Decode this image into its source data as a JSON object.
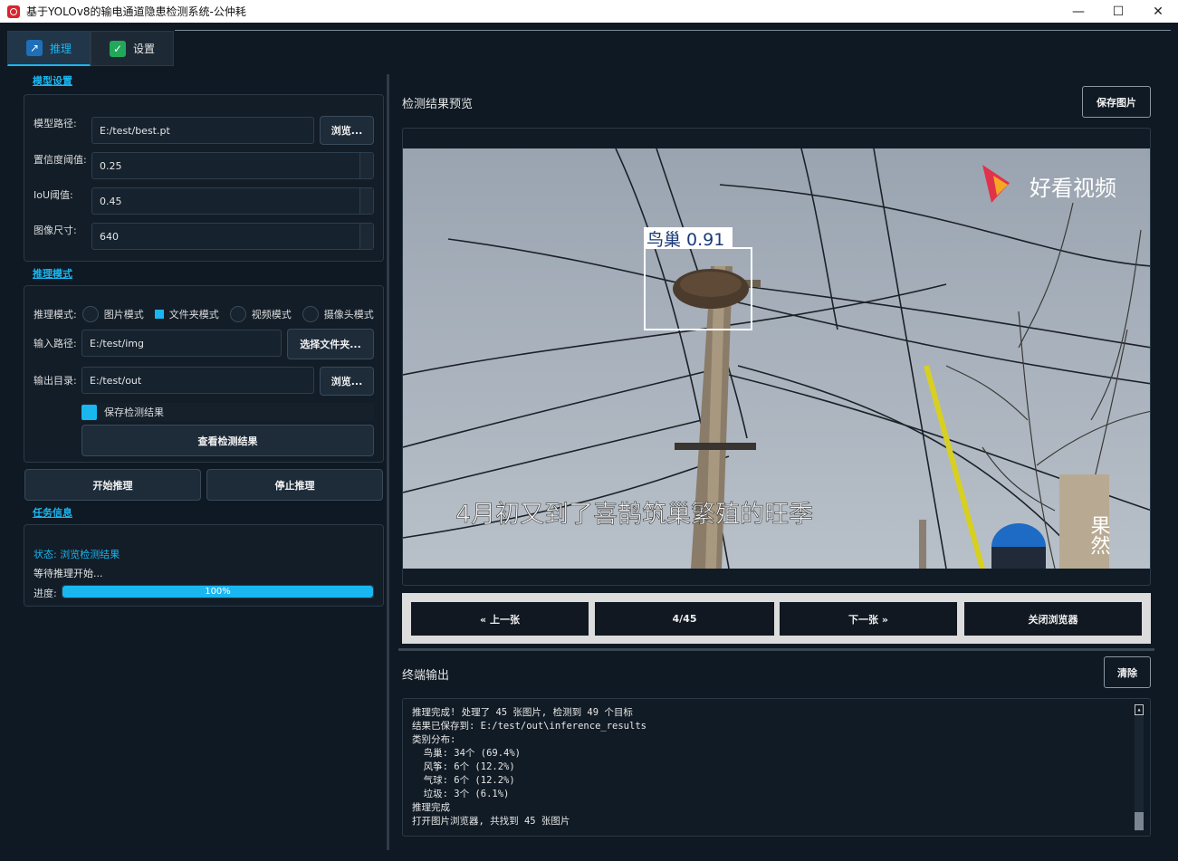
{
  "window": {
    "title": "基于YOLOv8的输电通道隐患检测系统-公仲耗",
    "controls": [
      "—",
      "☐",
      "✕"
    ]
  },
  "tabs": [
    {
      "label": "推理",
      "icon": "chart-icon",
      "active": true
    },
    {
      "label": "设置",
      "icon": "check-icon",
      "active": false
    }
  ],
  "model": {
    "section_title": "模型设置",
    "path_label": "模型路径:",
    "path_value": "E:/test/best.pt",
    "browse_label": "浏览...",
    "conf_label": "置信度阈值:",
    "conf_value": "0.25",
    "iou_label": "IoU阈值:",
    "iou_value": "0.45",
    "imgsz_label": "图像尺寸:",
    "imgsz_value": "640"
  },
  "mode": {
    "section_title": "推理模式",
    "mode_label": "推理模式:",
    "options": [
      "图片模式",
      "文件夹模式",
      "视频模式",
      "摄像头模式"
    ],
    "selected": "文件夹模式",
    "input_label": "输入路径:",
    "input_value": "E:/test/img",
    "select_folder_label": "选择文件夹...",
    "output_label": "输出目录:",
    "output_value": "E:/test/out",
    "browse_label": "浏览...",
    "save_results_label": "保存检测结果",
    "save_results_checked": true,
    "view_results_label": "查看检测结果"
  },
  "actions": {
    "start_label": "开始推理",
    "stop_label": "停止推理"
  },
  "task": {
    "section_title": "任务信息",
    "status": "状态: 浏览检测结果",
    "message": "等待推理开始...",
    "progress_label": "进度:",
    "progress_value": 100,
    "progress_text": "100%"
  },
  "preview": {
    "title": "检测结果预览",
    "save_label": "保存图片",
    "detection_label": "鸟巢 0.91",
    "watermark": "好看视频",
    "subtitle": "4月初又到了喜鹊筑巢繁殖的旺季",
    "corner_mark": "果然"
  },
  "navigator": {
    "prev_label": "« 上一张",
    "counter": "4/45",
    "next_label": "下一张 »",
    "close_label": "关闭浏览器"
  },
  "terminal": {
    "title": "终端输出",
    "clear_label": "清除",
    "lines": [
      "推理完成! 处理了 45 张图片, 检测到 49 个目标",
      "结果已保存到: E:/test/out\\inference_results",
      "类别分布:",
      "  鸟巢: 34个 (69.4%)",
      "  风筝: 6个 (12.2%)",
      "  气球: 6个 (12.2%)",
      "  垃圾: 3个 (6.1%)",
      "推理完成",
      "打开图片浏览器, 共找到 45 张图片"
    ]
  },
  "colors": {
    "accent": "#19b6f0",
    "background": "#0f1923",
    "detection_box": "#ffffff"
  }
}
